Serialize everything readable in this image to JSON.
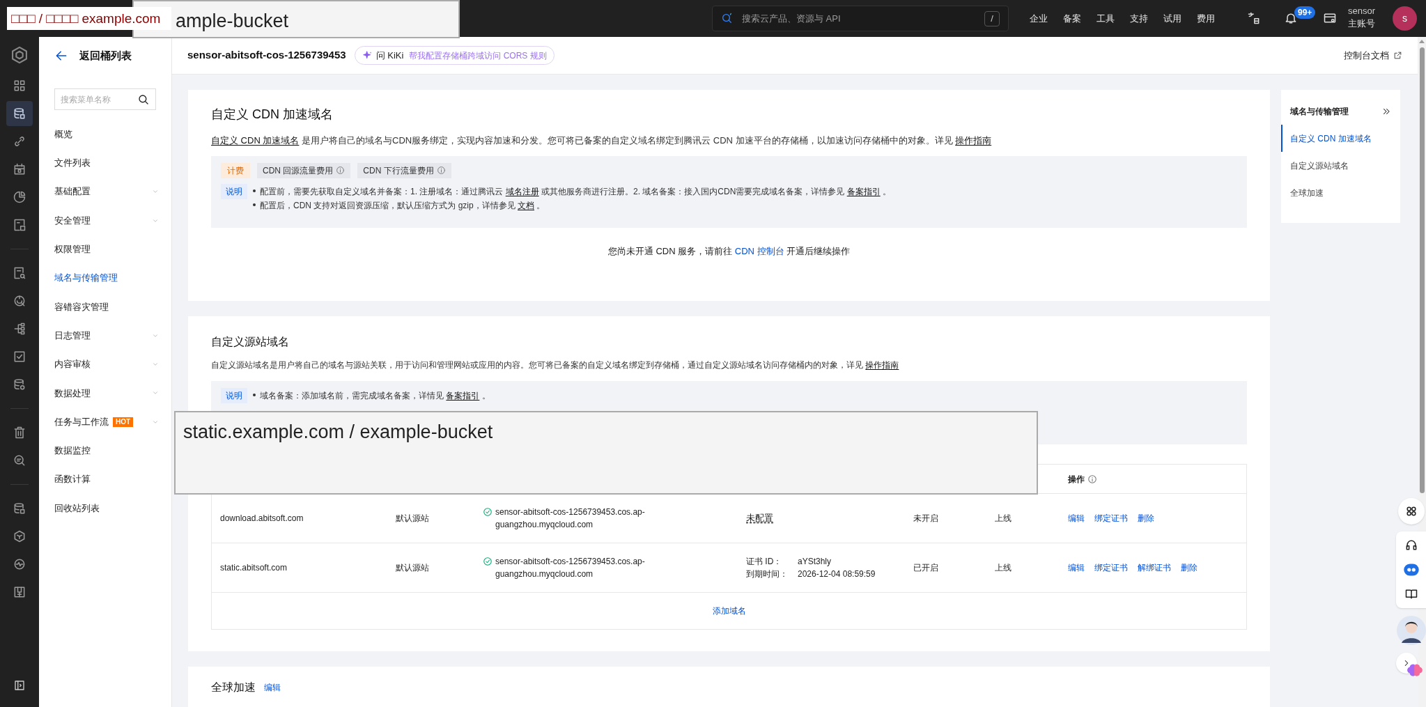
{
  "overlay_label": {
    "text": "□□□ / □□□□ example.com"
  },
  "overlay_top_box": {
    "text": "ample-bucket"
  },
  "overlay_middle_box": {
    "text": "static.example.com / example-bucket"
  },
  "topbar": {
    "search": {
      "placeholder": "搜索云产品、资源与 API",
      "shortcut": "/"
    },
    "nav": [
      "企业",
      "备案",
      "工具",
      "支持",
      "试用",
      "费用"
    ],
    "notification_badge": "99+",
    "account": {
      "name": "sensor",
      "role": "主账号",
      "avatar": "s"
    }
  },
  "rail": {
    "groups": [
      {
        "items": [
          {
            "selected": false
          },
          {
            "selected": true
          },
          {
            "selected": false
          },
          {
            "selected": false
          },
          {
            "selected": false
          },
          {
            "selected": false
          }
        ]
      },
      {
        "items": [
          {
            "selected": false
          },
          {
            "selected": false
          },
          {
            "selected": false
          },
          {
            "selected": false
          },
          {
            "selected": false
          }
        ]
      },
      {
        "items": [
          {
            "selected": false
          },
          {
            "selected": false
          }
        ]
      },
      {
        "items": [
          {
            "selected": false
          },
          {
            "selected": false
          },
          {
            "selected": false
          },
          {
            "selected": false
          }
        ]
      }
    ]
  },
  "sidebar": {
    "back": "返回桶列表",
    "search_placeholder": "搜索菜单名称",
    "items": [
      {
        "label": "概览",
        "selected": false,
        "expandable": false
      },
      {
        "label": "文件列表",
        "selected": false,
        "expandable": false
      },
      {
        "label": "基础配置",
        "selected": false,
        "expandable": true
      },
      {
        "label": "安全管理",
        "selected": false,
        "expandable": true
      },
      {
        "label": "权限管理",
        "selected": false,
        "expandable": false
      },
      {
        "label": "域名与传输管理",
        "selected": true,
        "expandable": false
      },
      {
        "label": "容错容灾管理",
        "selected": false,
        "expandable": false
      },
      {
        "label": "日志管理",
        "selected": false,
        "expandable": true
      },
      {
        "label": "内容审核",
        "selected": false,
        "expandable": true
      },
      {
        "label": "数据处理",
        "selected": false,
        "expandable": true
      },
      {
        "label": "任务与工作流",
        "badge": "HOT",
        "selected": false,
        "expandable": true
      },
      {
        "label": "数据监控",
        "selected": false,
        "expandable": false
      },
      {
        "label": "函数计算",
        "selected": false,
        "expandable": false
      },
      {
        "label": "回收站列表",
        "selected": false,
        "expandable": false
      }
    ]
  },
  "header": {
    "title": "sensor-abitsoft-cos-1256739453",
    "kiki": {
      "label": "问 KiKi",
      "prompt": "帮我配置存储桶跨域访问 CORS 规则"
    },
    "docs_link": "控制台文档"
  },
  "cdn_section": {
    "title": "自定义 CDN 加速域名",
    "description": [
      {
        "kind": "link",
        "text": "自定义 CDN 加速域名"
      },
      {
        "kind": "text",
        "text": " 是用户将自己的域名与CDN服务绑定，实现内容加速和分发。您可将已备案的自定义域名绑定到腾讯云 CDN 加速平台的存储桶，以加速访问存储桶中的对象。详见 "
      },
      {
        "kind": "link",
        "text": "操作指南"
      }
    ],
    "billing": {
      "label": "计费",
      "tags": [
        "CDN 回源流量费用",
        "CDN 下行流量费用"
      ]
    },
    "notes": {
      "label": "说明",
      "lines": [
        [
          {
            "kind": "text",
            "text": "配置前，需要先获取自定义域名并备案：1. 注册域名：通过腾讯云 "
          },
          {
            "kind": "link",
            "text": "域名注册"
          },
          {
            "kind": "text",
            "text": " 或其他服务商进行注册。2. 域名备案：接入国内CDN需要完成域名备案，详情参见 "
          },
          {
            "kind": "link",
            "text": "备案指引"
          },
          {
            "kind": "text",
            "text": " 。"
          }
        ],
        [
          {
            "kind": "text",
            "text": "配置后，CDN 支持对返回资源压缩，默认压缩方式为 gzip，详情参见 "
          },
          {
            "kind": "link",
            "text": "文档"
          },
          {
            "kind": "text",
            "text": " 。"
          }
        ]
      ]
    },
    "notice": [
      {
        "kind": "text",
        "text": "您尚未开通 CDN 服务，请前往 "
      },
      {
        "kind": "console_link",
        "text": "CDN 控制台"
      },
      {
        "kind": "text",
        "text": " 开通后继续操作"
      }
    ]
  },
  "origin_section": {
    "title": "自定义源站域名",
    "description": [
      {
        "kind": "text",
        "text": "自定义源站域名是用户将自己的域名与源站关联，用于访问和管理网站或应用的内容。您可将已备案的自定义域名绑定到存储桶，通过自定义源站域名访问存储桶内的对象，详见 "
      },
      {
        "kind": "link",
        "text": "操作指南"
      }
    ],
    "notes": {
      "label": "说明",
      "lines": [
        [
          {
            "kind": "text",
            "text": "域名备案：添加域名前，需完成域名备案，详情见 "
          },
          {
            "kind": "link",
            "text": "备案指引"
          },
          {
            "kind": "text",
            "text": " 。"
          }
        ]
      ]
    },
    "table": {
      "visible_header": "操作",
      "rows": [
        {
          "domain": "download.abitsoft.com",
          "origin_type": "默认源站",
          "origin": "sensor-abitsoft-cos-1256739453.cos.ap-guangzhou.myqcloud.com",
          "cert": {
            "kind": "none",
            "text": "未配置"
          },
          "https": "未开启",
          "status": "上线",
          "actions": [
            "编辑",
            "绑定证书",
            "删除"
          ]
        },
        {
          "domain": "static.abitsoft.com",
          "origin_type": "默认源站",
          "origin": "sensor-abitsoft-cos-1256739453.cos.ap-guangzhou.myqcloud.com",
          "cert": {
            "kind": "cert",
            "id_label": "证书 ID：",
            "id": "aYSt3hly",
            "expiry_label": "到期时间：",
            "expiry": "2026-12-04 08:59:59"
          },
          "https": "已开启",
          "status": "上线",
          "actions": [
            "编辑",
            "绑定证书",
            "解绑证书",
            "删除"
          ]
        }
      ],
      "add_button": "添加域名"
    }
  },
  "global_section": {
    "title": "全球加速",
    "edit": "编辑"
  },
  "right_nav": {
    "title": "域名与传输管理",
    "items": [
      {
        "label": "自定义 CDN 加速域名",
        "selected": true
      },
      {
        "label": "自定义源站域名",
        "selected": false
      },
      {
        "label": "全球加速",
        "selected": false
      }
    ]
  }
}
